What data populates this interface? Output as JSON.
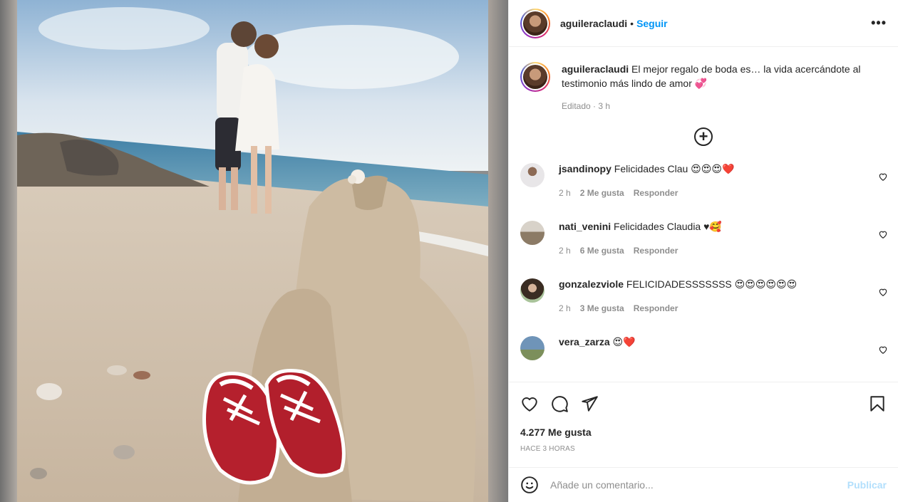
{
  "post": {
    "username": "aguileraclaudi",
    "separator": "•",
    "follow_label": "Seguir",
    "more_label": "•••",
    "caption_username": "aguileraclaudi",
    "caption_text": "El mejor regalo de boda es… la vida acercándote al testimonio más lindo de amor 💞",
    "caption_meta": "Editado · 3 h",
    "load_more_label": "+",
    "likes": "4.277 Me gusta",
    "time": "Hace 3 horas",
    "comment_placeholder": "Añade un comentario...",
    "publish_label": "Publicar",
    "photo_alt_icon": "photo-beach-baby-shoes"
  },
  "comments": [
    {
      "username": "jsandinopy",
      "text": "Felicidades Clau 😍😍😍❤️",
      "time": "2 h",
      "likes": "2 Me gusta",
      "reply": "Responder",
      "avatar_color": "#c9ccd4"
    },
    {
      "username": "nati_venini",
      "text": "Felicidades Claudia ♥🥰",
      "time": "2 h",
      "likes": "6 Me gusta",
      "reply": "Responder",
      "avatar_color": "#b8a58f"
    },
    {
      "username": "gonzalezviole",
      "text": "FELICIDADESSSSSSS 😍😍😍😍😍😍",
      "time": "2 h",
      "likes": "3 Me gusta",
      "reply": "Responder",
      "avatar_color": "#6b5a4b"
    },
    {
      "username": "vera_zarza",
      "text": "😍❤️",
      "time": "",
      "likes": "",
      "reply": "",
      "avatar_color": "#6f94b8"
    }
  ],
  "colors": {
    "accent": "#0095f6",
    "publish_disabled": "#b2dffc",
    "muted": "#8e8e8e",
    "text": "#262626"
  }
}
